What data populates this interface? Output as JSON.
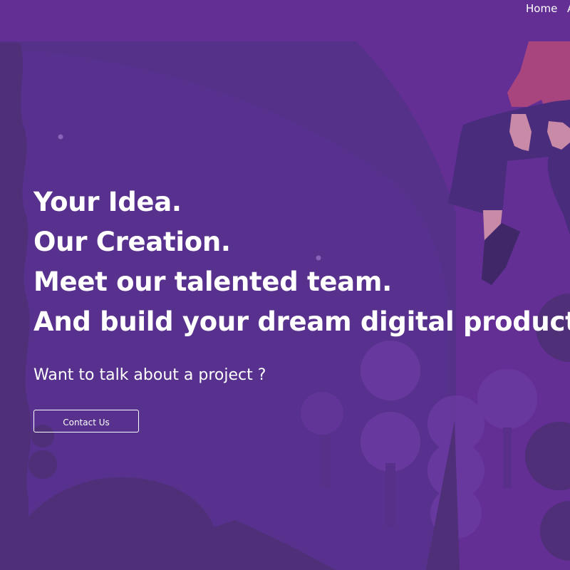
{
  "nav": {
    "items": [
      {
        "label": "Home"
      },
      {
        "label": "A"
      }
    ]
  },
  "hero": {
    "headline": [
      "Your Idea.",
      "Our Creation.",
      "Meet our talented team.",
      "And build your dream digital products."
    ],
    "subtitle": "Want to talk about a project ?",
    "cta_label": "Contact Us"
  },
  "colors": {
    "background": "#632f95",
    "hill_dark": "#4e2f78",
    "hill_mid": "#57318a",
    "tree": "#6a3aa0",
    "shirt": "#a8457e",
    "skin": "#c98aa8",
    "text": "#ffffff"
  }
}
